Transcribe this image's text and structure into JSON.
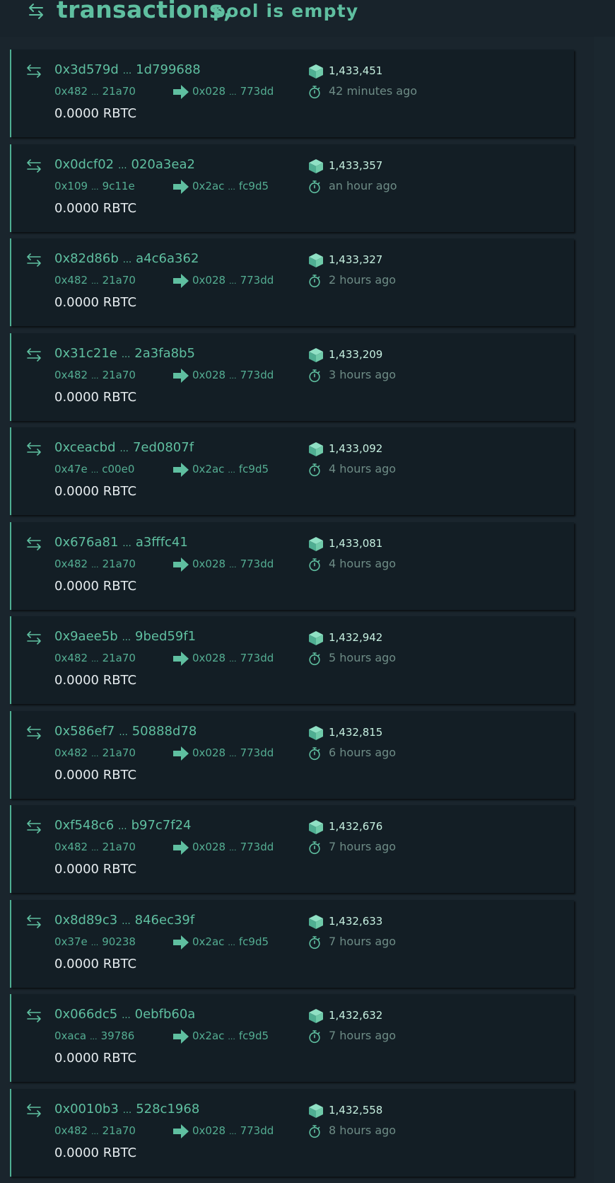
{
  "header": {
    "title": "transactions,",
    "subtitle": "pool is empty",
    "icon": "swap-arrows-icon"
  },
  "colors": {
    "background": "#1a252d",
    "card": "#131e25",
    "accent": "#5fbfa0",
    "value_text": "#e6ecef",
    "muted_text": "#6e8c86"
  },
  "icons": {
    "transaction": "swap-arrows-icon",
    "direction": "arrow-right-icon",
    "block": "cube-icon",
    "time": "stopwatch-icon"
  },
  "transactions": [
    {
      "hash_start": "0x3d579d",
      "hash_end": "1d799688",
      "from_start": "0x482",
      "from_end": "21a70",
      "to_start": "0x028",
      "to_end": "773dd",
      "value": "0.0000 RBTC",
      "block": "1,433,451",
      "age": "42 minutes ago"
    },
    {
      "hash_start": "0x0dcf02",
      "hash_end": "020a3ea2",
      "from_start": "0x109",
      "from_end": "9c11e",
      "to_start": "0x2ac",
      "to_end": "fc9d5",
      "value": "0.0000 RBTC",
      "block": "1,433,357",
      "age": "an hour ago"
    },
    {
      "hash_start": "0x82d86b",
      "hash_end": "a4c6a362",
      "from_start": "0x482",
      "from_end": "21a70",
      "to_start": "0x028",
      "to_end": "773dd",
      "value": "0.0000 RBTC",
      "block": "1,433,327",
      "age": "2 hours ago"
    },
    {
      "hash_start": "0x31c21e",
      "hash_end": "2a3fa8b5",
      "from_start": "0x482",
      "from_end": "21a70",
      "to_start": "0x028",
      "to_end": "773dd",
      "value": "0.0000 RBTC",
      "block": "1,433,209",
      "age": "3 hours ago"
    },
    {
      "hash_start": "0xceacbd",
      "hash_end": "7ed0807f",
      "from_start": "0x47e",
      "from_end": "c00e0",
      "to_start": "0x2ac",
      "to_end": "fc9d5",
      "value": "0.0000 RBTC",
      "block": "1,433,092",
      "age": "4 hours ago"
    },
    {
      "hash_start": "0x676a81",
      "hash_end": "a3fffc41",
      "from_start": "0x482",
      "from_end": "21a70",
      "to_start": "0x028",
      "to_end": "773dd",
      "value": "0.0000 RBTC",
      "block": "1,433,081",
      "age": "4 hours ago"
    },
    {
      "hash_start": "0x9aee5b",
      "hash_end": "9bed59f1",
      "from_start": "0x482",
      "from_end": "21a70",
      "to_start": "0x028",
      "to_end": "773dd",
      "value": "0.0000 RBTC",
      "block": "1,432,942",
      "age": "5 hours ago"
    },
    {
      "hash_start": "0x586ef7",
      "hash_end": "50888d78",
      "from_start": "0x482",
      "from_end": "21a70",
      "to_start": "0x028",
      "to_end": "773dd",
      "value": "0.0000 RBTC",
      "block": "1,432,815",
      "age": "6 hours ago"
    },
    {
      "hash_start": "0xf548c6",
      "hash_end": "b97c7f24",
      "from_start": "0x482",
      "from_end": "21a70",
      "to_start": "0x028",
      "to_end": "773dd",
      "value": "0.0000 RBTC",
      "block": "1,432,676",
      "age": "7 hours ago"
    },
    {
      "hash_start": "0x8d89c3",
      "hash_end": "846ec39f",
      "from_start": "0x37e",
      "from_end": "90238",
      "to_start": "0x2ac",
      "to_end": "fc9d5",
      "value": "0.0000 RBTC",
      "block": "1,432,633",
      "age": "7 hours ago"
    },
    {
      "hash_start": "0x066dc5",
      "hash_end": "0ebfb60a",
      "from_start": "0xaca",
      "from_end": "39786",
      "to_start": "0x2ac",
      "to_end": "fc9d5",
      "value": "0.0000 RBTC",
      "block": "1,432,632",
      "age": "7 hours ago"
    },
    {
      "hash_start": "0x0010b3",
      "hash_end": "528c1968",
      "from_start": "0x482",
      "from_end": "21a70",
      "to_start": "0x028",
      "to_end": "773dd",
      "value": "0.0000 RBTC",
      "block": "1,432,558",
      "age": "8 hours ago"
    }
  ]
}
